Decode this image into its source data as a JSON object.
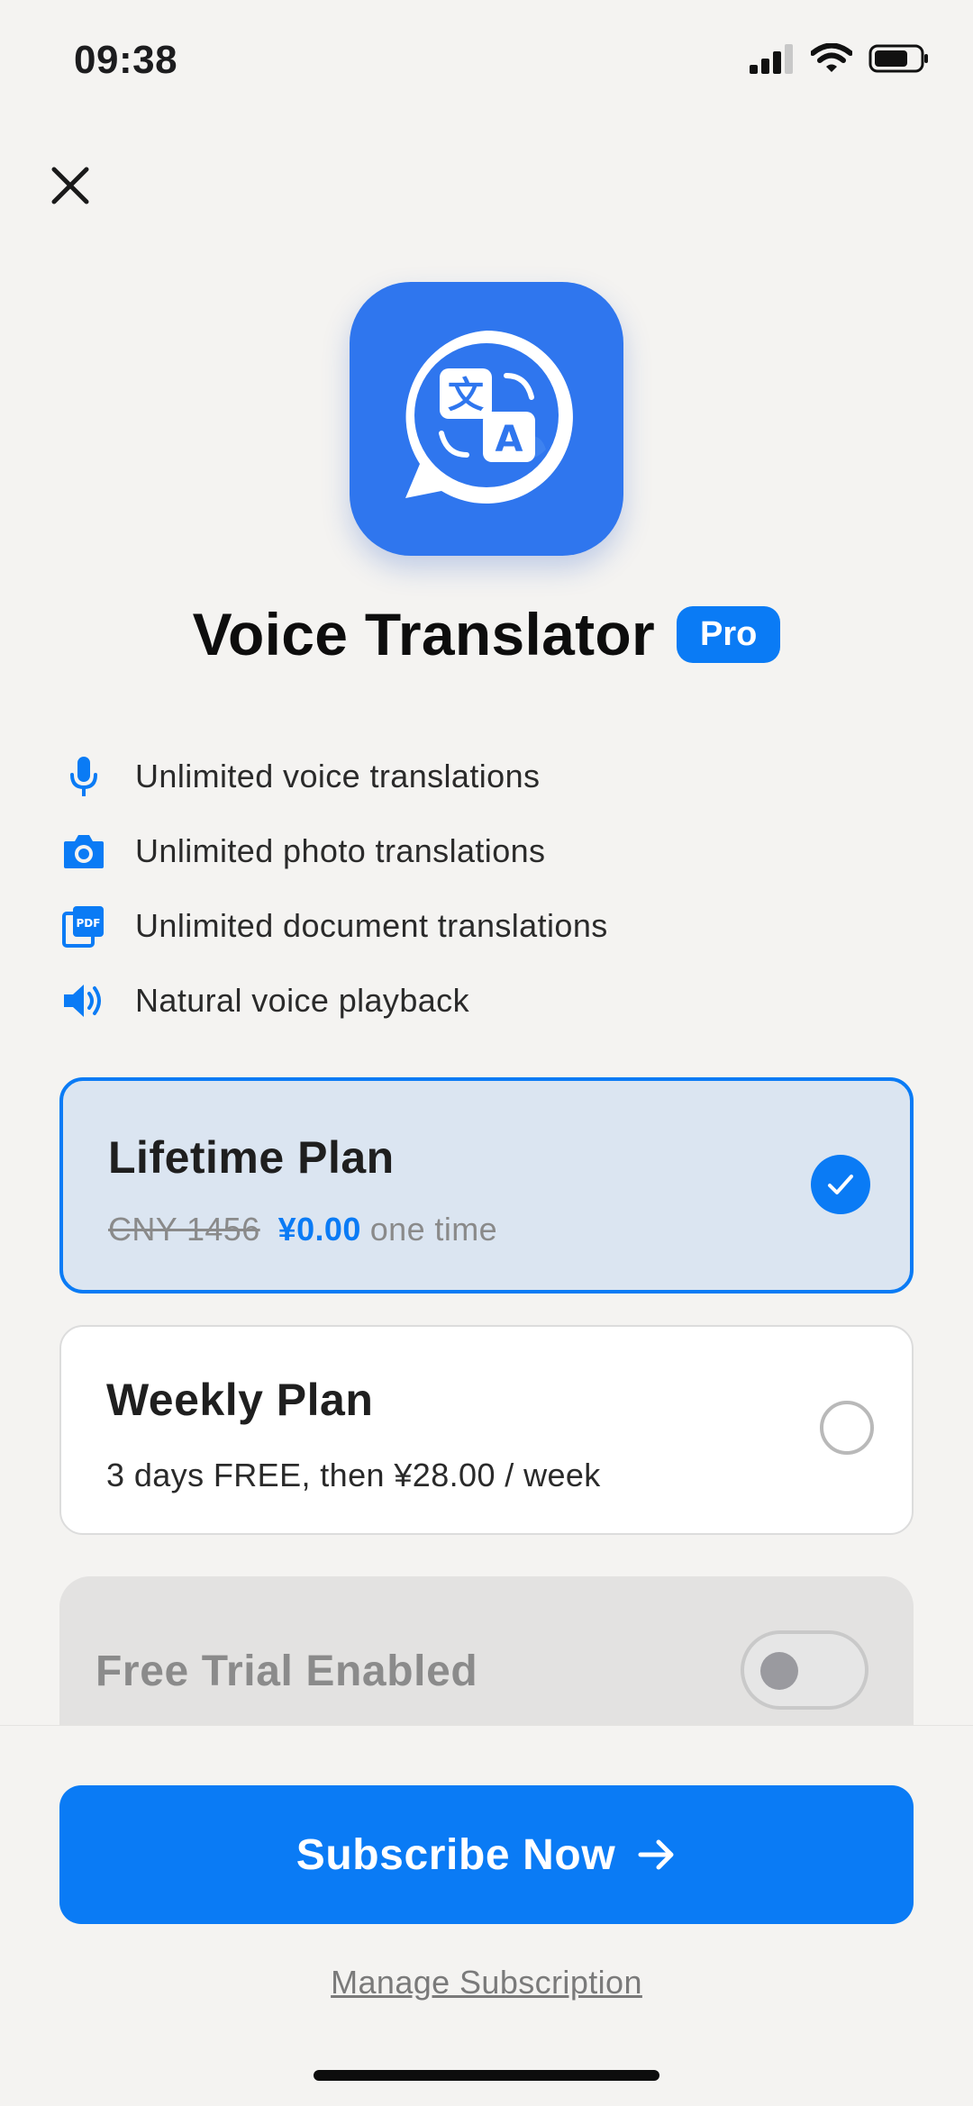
{
  "status_bar": {
    "time": "09:38"
  },
  "app": {
    "title": "Voice Translator",
    "badge": "Pro"
  },
  "features": [
    {
      "icon": "microphone-icon",
      "label": "Unlimited voice translations"
    },
    {
      "icon": "camera-icon",
      "label": "Unlimited photo translations"
    },
    {
      "icon": "pdf-document-icon",
      "label": "Unlimited document translations"
    },
    {
      "icon": "speaker-icon",
      "label": "Natural voice playback"
    }
  ],
  "plans": {
    "lifetime": {
      "name": "Lifetime Plan",
      "old_price": "CNY 1456",
      "price": "¥0.00",
      "suffix": "one time",
      "selected": true
    },
    "weekly": {
      "name": "Weekly Plan",
      "details": "3 days FREE, then ¥28.00 / week",
      "selected": false
    }
  },
  "free_trial": {
    "label": "Free Trial Enabled",
    "enabled": false
  },
  "cta": {
    "subscribe_label": "Subscribe Now",
    "manage_label": "Manage Subscription"
  },
  "colors": {
    "accent": "#0a7bf5",
    "icon_bg": "#2f76ee",
    "selected_plan_bg": "#dbe5f1"
  }
}
